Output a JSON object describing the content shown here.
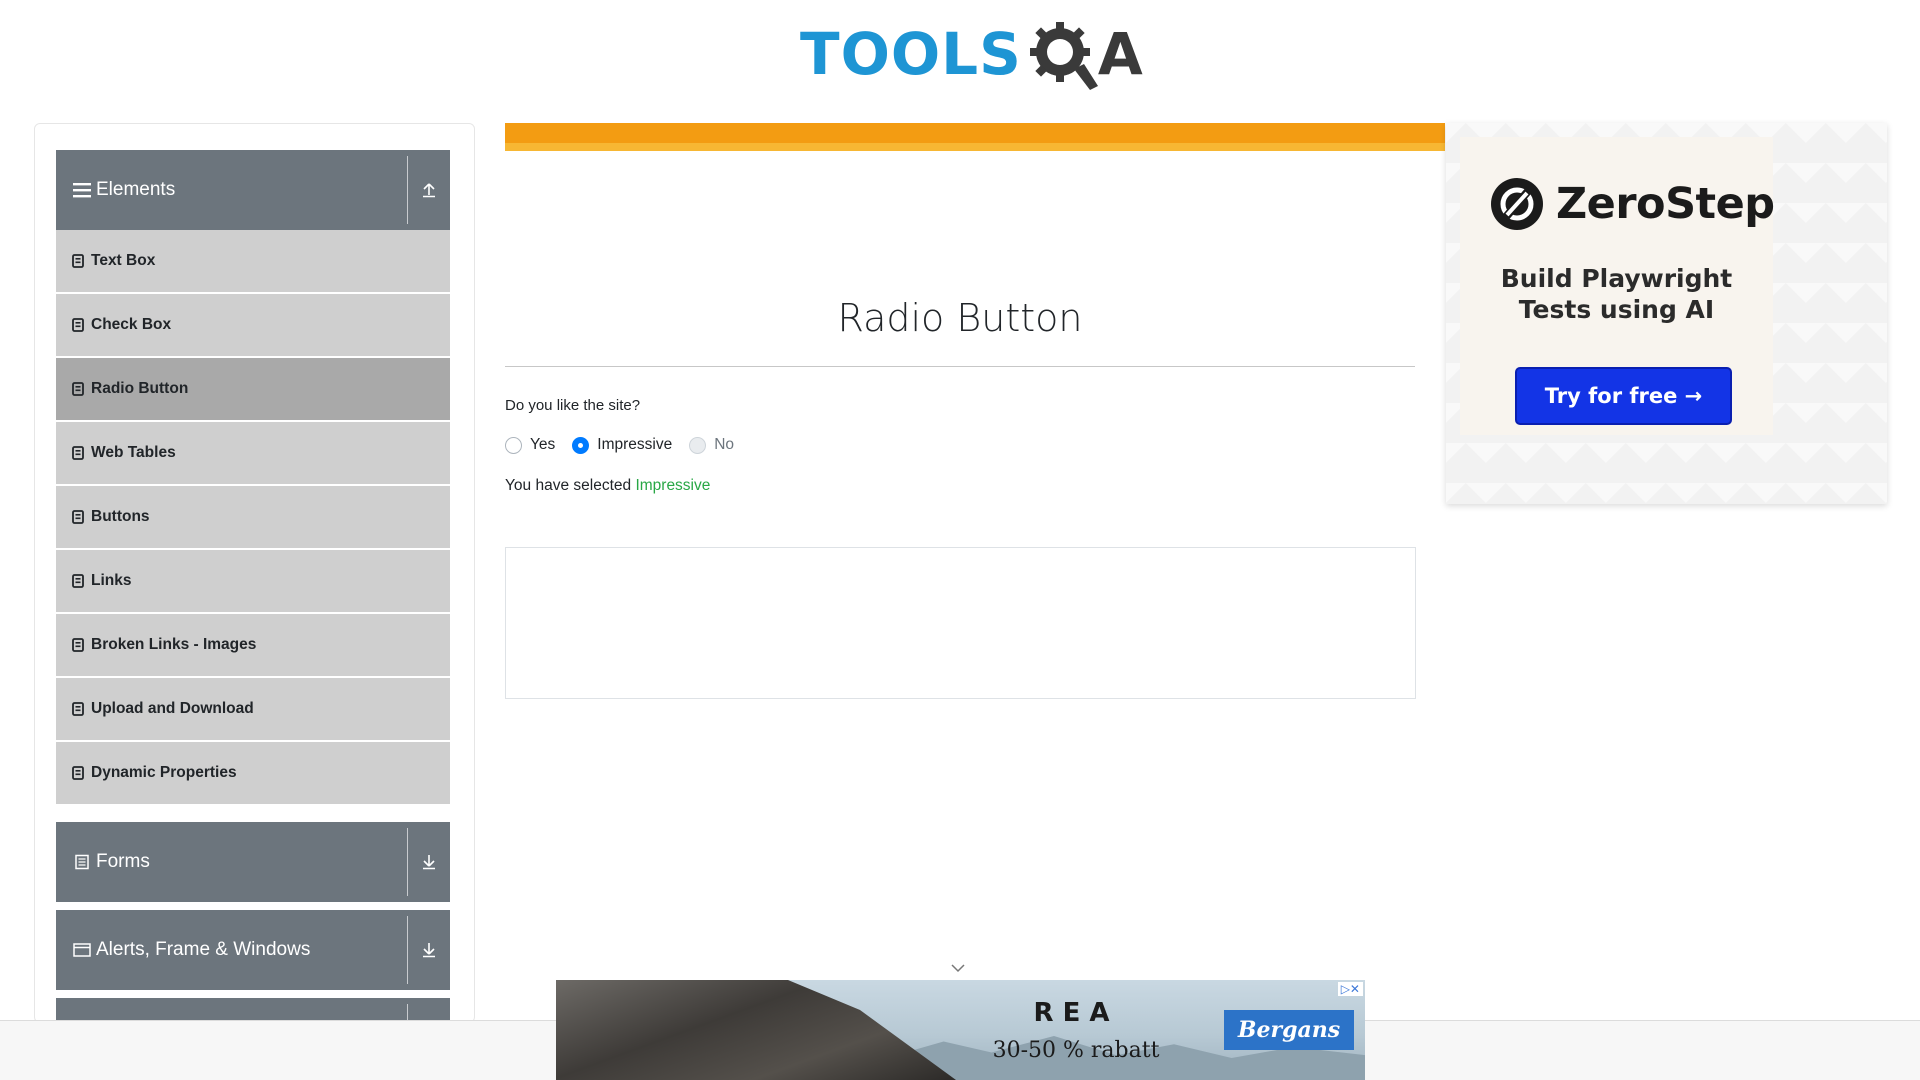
{
  "header": {
    "logo_tools": "TOOLS",
    "logo_qa_a": "A"
  },
  "sidebar": {
    "groups": [
      {
        "label": "Elements",
        "icon": "hamburger-icon",
        "state": "expanded"
      },
      {
        "label": "Forms",
        "icon": "form-icon",
        "state": "collapsed"
      },
      {
        "label": "Alerts, Frame & Windows",
        "icon": "window-icon",
        "state": "collapsed"
      }
    ],
    "items": [
      {
        "label": "Text Box"
      },
      {
        "label": "Check Box"
      },
      {
        "label": "Radio Button",
        "active": true
      },
      {
        "label": "Web Tables"
      },
      {
        "label": "Buttons"
      },
      {
        "label": "Links"
      },
      {
        "label": "Broken Links - Images"
      },
      {
        "label": "Upload and Download"
      },
      {
        "label": "Dynamic Properties"
      }
    ]
  },
  "main": {
    "title": "Radio Button",
    "question": "Do you like the site?",
    "options": [
      {
        "label": "Yes",
        "checked": false,
        "disabled": false
      },
      {
        "label": "Impressive",
        "checked": true,
        "disabled": false
      },
      {
        "label": "No",
        "checked": false,
        "disabled": true
      }
    ],
    "result_prefix": "You have selected",
    "result_value": "Impressive"
  },
  "right_ad": {
    "brand": "ZeroStep",
    "tagline_line1": "Build Playwright",
    "tagline_line2": "Tests using AI",
    "cta": "Try for free →"
  },
  "bottom_ad": {
    "headline": "REA",
    "offer": "30-50 % rabatt",
    "brand": "Bergans",
    "adchoices": "▷✕"
  },
  "colors": {
    "sidebar_header": "#6c757d",
    "menu_item": "#cfcfcf",
    "menu_item_active": "#a9a9a9",
    "selected_text": "#28a745",
    "radio_checked": "#007bff",
    "logo_blue": "#1e95d4",
    "cta_blue": "#1334e6"
  }
}
